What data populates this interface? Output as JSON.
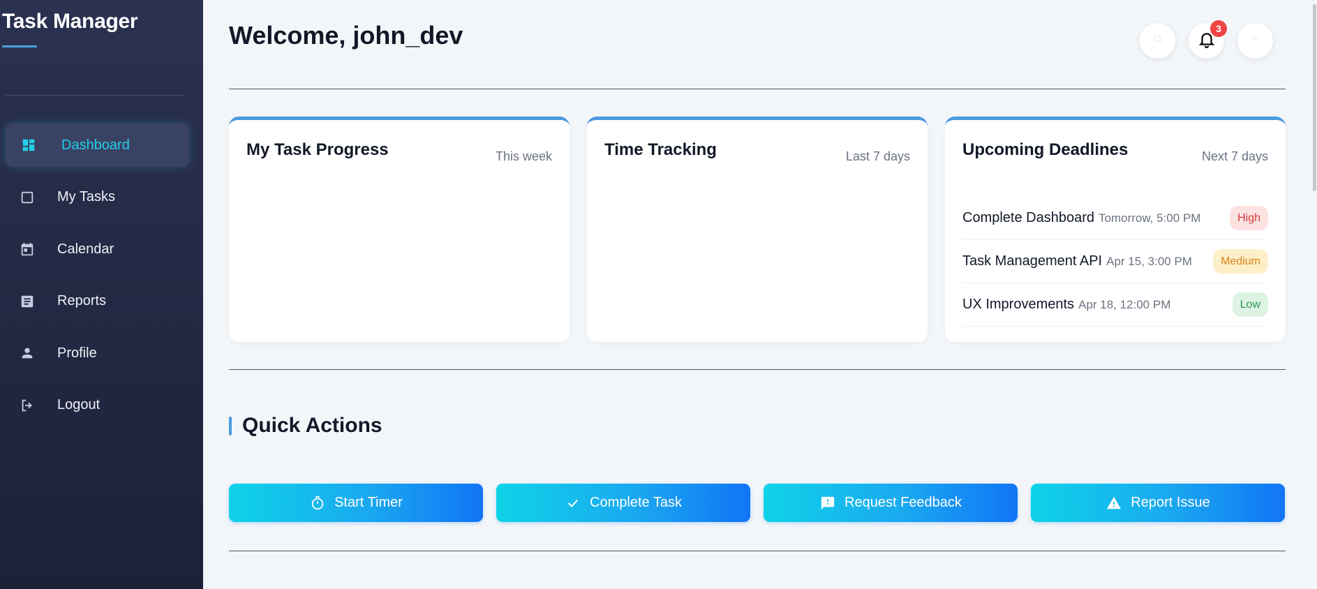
{
  "sidebar": {
    "brand": "Task Manager",
    "items": [
      {
        "label": "Dashboard",
        "icon": "dashboard-icon",
        "active": true
      },
      {
        "label": "My Tasks",
        "icon": "checkbox-icon",
        "active": false
      },
      {
        "label": "Calendar",
        "icon": "calendar-icon",
        "active": false
      },
      {
        "label": "Reports",
        "icon": "document-icon",
        "active": false
      },
      {
        "label": "Profile",
        "icon": "user-icon",
        "active": false
      },
      {
        "label": "Logout",
        "icon": "logout-icon",
        "active": false
      }
    ]
  },
  "header": {
    "welcome": "Welcome, john_dev",
    "notification_count": "3",
    "icons": [
      "search-icon",
      "bell-icon",
      "settings-icon"
    ]
  },
  "cards": {
    "progress": {
      "title": "My Task Progress",
      "subtitle": "This week"
    },
    "time": {
      "title": "Time Tracking",
      "subtitle": "Last 7 days"
    },
    "deadlines": {
      "title": "Upcoming Deadlines",
      "subtitle": "Next 7 days",
      "items": [
        {
          "name": "Complete Dashboard",
          "date": "Tomorrow, 5:00 PM",
          "priority": "High"
        },
        {
          "name": "Task Management API",
          "date": "Apr 15, 3:00 PM",
          "priority": "Medium"
        },
        {
          "name": "UX Improvements",
          "date": "Apr 18, 12:00 PM",
          "priority": "Low"
        }
      ]
    }
  },
  "quick_actions": {
    "title": "Quick Actions",
    "buttons": [
      {
        "label": "Start Timer",
        "icon": "timer-icon"
      },
      {
        "label": "Complete Task",
        "icon": "check-icon"
      },
      {
        "label": "Request Feedback",
        "icon": "feedback-icon"
      },
      {
        "label": "Report Issue",
        "icon": "warning-icon"
      }
    ]
  },
  "colors": {
    "accent": "#22cfe8",
    "card_top": "#4a9ae0",
    "high": "#d23c3c",
    "medium": "#d9811a",
    "low": "#2f9a53"
  }
}
